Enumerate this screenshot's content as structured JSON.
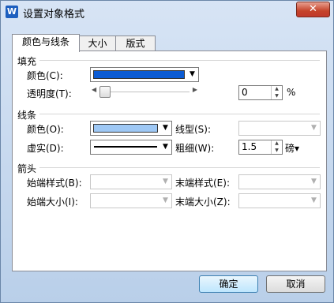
{
  "window": {
    "title": "设置对象格式",
    "app_icon": "W",
    "close_glyph": "✕"
  },
  "tabs": [
    {
      "label": "颜色与线条",
      "active": true
    },
    {
      "label": "大小",
      "active": false
    },
    {
      "label": "版式",
      "active": false
    }
  ],
  "fill": {
    "section": "填充",
    "color_label": "颜色(C):",
    "color_value": "#0b5bd3",
    "transparency_label": "透明度(T):",
    "transparency_value": "0",
    "transparency_unit": "%",
    "transparency_level": 0
  },
  "line": {
    "section": "线条",
    "color_label": "颜色(O):",
    "color_value": "#9ec8f5",
    "style_label": "线型(S):",
    "dash_label": "虚实(D):",
    "weight_label": "粗细(W):",
    "weight_value": "1.5",
    "weight_unit": "磅▾"
  },
  "arrows": {
    "section": "箭头",
    "begin_style_label": "始端样式(B):",
    "end_style_label": "末端样式(E):",
    "begin_size_label": "始端大小(I):",
    "end_size_label": "末端大小(Z):"
  },
  "buttons": {
    "ok": "确定",
    "cancel": "取消"
  },
  "icons": {
    "dropdown": "▼",
    "spin_up": "▲",
    "spin_down": "▼",
    "slider_left": "◀",
    "slider_right": "▶"
  }
}
